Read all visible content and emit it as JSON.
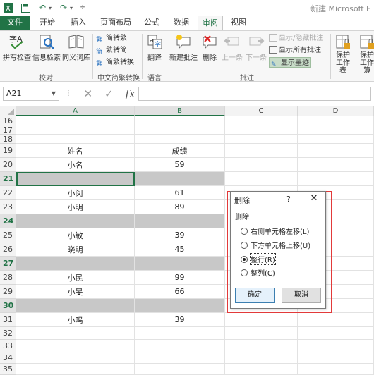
{
  "titlebar": {
    "app_icon": "excel-icon",
    "save_icon": "save-icon",
    "undo_icon": "undo-icon",
    "redo_icon": "redo-icon",
    "title": "新建 Microsoft E"
  },
  "tabs": [
    {
      "label": "文件"
    },
    {
      "label": "开始"
    },
    {
      "label": "插入"
    },
    {
      "label": "页面布局"
    },
    {
      "label": "公式"
    },
    {
      "label": "数据"
    },
    {
      "label": "审阅",
      "active": true
    },
    {
      "label": "视图"
    }
  ],
  "ribbon": {
    "spell": "拼写检查",
    "research": "信息检索",
    "thesaurus": "同义词库",
    "group_proofing": "校对",
    "to_trad": "简转繁",
    "to_simp": "繁转简",
    "convert": "简繁转换",
    "group_chinese": "中文简繁转换",
    "translate": "翻译",
    "group_language": "语言",
    "new_comment": "新建批注",
    "delete": "删除",
    "prev": "上一条",
    "next": "下一条",
    "show_hide": "显示/隐藏批注",
    "show_all": "显示所有批注",
    "show_ink": "显示墨迹",
    "group_comments": "批注",
    "protect_sheet": "保护工作表",
    "protect_wb": "保护工作簿"
  },
  "formula_bar": {
    "name_box": "A21",
    "formula": ""
  },
  "columns": [
    "A",
    "B",
    "C",
    "D"
  ],
  "rows": [
    {
      "num": "16",
      "a": "",
      "b": ""
    },
    {
      "num": "17",
      "a": "",
      "b": ""
    },
    {
      "num": "18",
      "a": "",
      "b": ""
    },
    {
      "num": "19",
      "a": "姓名",
      "b": "成绩"
    },
    {
      "num": "20",
      "a": "小名",
      "b": "59"
    },
    {
      "num": "21",
      "a": "",
      "b": "",
      "gray": true,
      "sel": true
    },
    {
      "num": "22",
      "a": "小闵",
      "b": "61"
    },
    {
      "num": "23",
      "a": "小明",
      "b": "89"
    },
    {
      "num": "24",
      "a": "",
      "b": "",
      "gray": true,
      "sel": true
    },
    {
      "num": "25",
      "a": "小敏",
      "b": "39"
    },
    {
      "num": "26",
      "a": "晓明",
      "b": "45"
    },
    {
      "num": "27",
      "a": "",
      "b": "",
      "gray": true,
      "sel": true
    },
    {
      "num": "28",
      "a": "小民",
      "b": "99"
    },
    {
      "num": "29",
      "a": "小旻",
      "b": "66"
    },
    {
      "num": "30",
      "a": "",
      "b": "",
      "gray": true,
      "sel": true
    },
    {
      "num": "31",
      "a": "小呜",
      "b": "39"
    },
    {
      "num": "32",
      "a": "",
      "b": ""
    },
    {
      "num": "33",
      "a": "",
      "b": ""
    },
    {
      "num": "34",
      "a": "",
      "b": ""
    },
    {
      "num": "35",
      "a": "",
      "b": ""
    }
  ],
  "dialog": {
    "title": "删除",
    "help": "?",
    "close": "✕",
    "group": "删除",
    "options": [
      {
        "label": "右侧单元格左移(L)",
        "selected": false
      },
      {
        "label": "下方单元格上移(U)",
        "selected": false
      },
      {
        "label": "整行(R)",
        "selected": true
      },
      {
        "label": "整列(C)",
        "selected": false
      }
    ],
    "ok": "确定",
    "cancel": "取消"
  },
  "colors": {
    "excel_green": "#217346",
    "gray_fill": "#c8c8c8",
    "highlight_red": "#e23a3a"
  }
}
